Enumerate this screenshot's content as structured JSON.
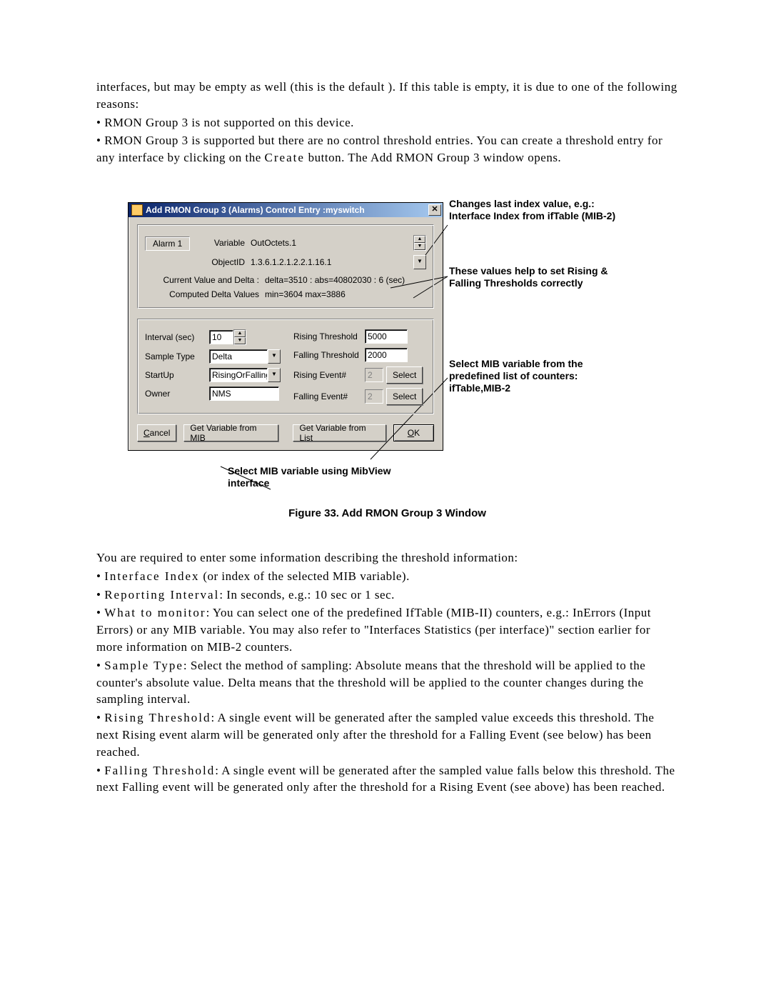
{
  "intro": {
    "p1": "interfaces, but may be empty as well (this is the default ). If this table is empty, it is due to one of the following reasons:",
    "b1": "• RMON Group 3 is not supported on this device.",
    "b2a": "• RMON Group 3 is supported but there are no control threshold entries. You can create a threshold entry for any interface by clicking on the ",
    "b2b": "Create",
    "b2c": " button. The Add RMON Group 3 window opens."
  },
  "dialog": {
    "title": "Add RMON Group 3 (Alarms) Control Entry :myswitch",
    "alarm_legend": "Alarm  1",
    "labels": {
      "variable": "Variable",
      "objectid": "ObjectID",
      "cvd": "Current Value and Delta :",
      "cdv": "Computed Delta Values",
      "interval": "Interval (sec)",
      "sample_type": "Sample Type",
      "startup": "StartUp",
      "owner": "Owner",
      "rising_th": "Rising Threshold",
      "falling_th": "Falling Threshold",
      "rising_ev": "Rising Event#",
      "falling_ev": "Falling Event#"
    },
    "values": {
      "variable": "OutOctets.1",
      "objectid": "1.3.6.1.2.1.2.2.1.16.1",
      "cvd": "delta=3510 : abs=40802030 : 6 (sec)",
      "cdv": "min=3604 max=3886",
      "interval": "10",
      "sample_type": "Delta",
      "startup": "RisingOrFalling",
      "owner": "NMS",
      "rising_th": "5000",
      "falling_th": "2000",
      "rising_ev": "2",
      "falling_ev": "2"
    },
    "buttons": {
      "select": "Select",
      "cancel": "Cancel",
      "get_mib": "Get Variable from MIB",
      "get_list": "Get Variable from List",
      "ok": "OK"
    }
  },
  "annotations": {
    "idx": "Changes last index value, e.g.: Interface Index from ifTable (MIB-2)",
    "thresh": "These values help to set Rising & Falling Thresholds correctly",
    "list": "Select MIB variable from the predefined list of counters: ifTable,MIB-2",
    "mibview": "Select MIB variable using MibView interface"
  },
  "figure_caption": "Figure 33. Add RMON Group 3 Window",
  "lower": {
    "lead": "You are required to enter some information describing the threshold information:",
    "items": [
      {
        "term": "Interface Index",
        "desc": " (or index of the selected MIB variable)."
      },
      {
        "term": "Reporting Interval",
        "desc": ": In seconds, e.g.: 10 sec or 1 sec."
      },
      {
        "term": "What to monitor",
        "desc": ": You can select one of the predefined IfTable (MIB-II) counters, e.g.: InErrors (Input Errors) or any MIB variable. You may also refer to \"Interfaces Statistics (per interface)\" section earlier for more information on MIB-2 counters."
      },
      {
        "term": "Sample Type",
        "desc": ": Select the method of sampling: Absolute means that the threshold will be applied to the counter's absolute value. Delta means that the threshold will be applied to the counter changes during the sampling interval."
      },
      {
        "term": "Rising Threshold",
        "desc": ": A single event will be generated after the sampled value exceeds this threshold. The next Rising event alarm will be generated only after the threshold for a Falling Event (see below) has been reached."
      },
      {
        "term": "Falling Threshold",
        "desc": ":  A single event will be generated after the sampled value falls below this threshold. The next Falling event will be generated only after the threshold for a Rising Event (see above) has been reached."
      }
    ]
  }
}
